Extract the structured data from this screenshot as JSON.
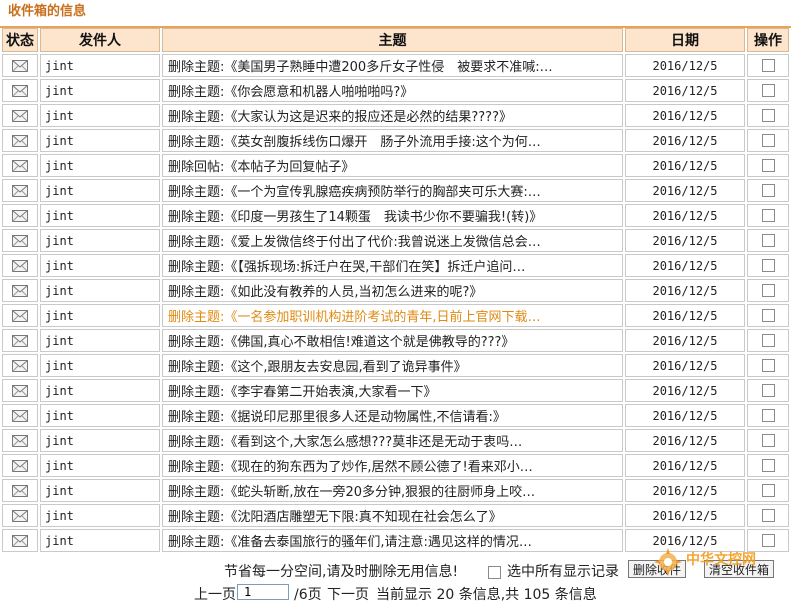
{
  "page": {
    "title": "收件箱的信息"
  },
  "table": {
    "headers": {
      "status": "状态",
      "sender": "发件人",
      "subject": "主题",
      "date": "日期",
      "op": "操作"
    },
    "rows": [
      {
        "sender": "jint",
        "subject": "删除主题:《美国男子熟睡中遭200多斤女子性侵　被要求不准喊:…",
        "date": "2016/12/5"
      },
      {
        "sender": "jint",
        "subject": "删除主题:《你会愿意和机器人啪啪啪吗?》",
        "date": "2016/12/5"
      },
      {
        "sender": "jint",
        "subject": "删除主题:《大家认为这是迟来的报应还是必然的结果????》",
        "date": "2016/12/5"
      },
      {
        "sender": "jint",
        "subject": "删除主题:《英女剖腹拆线伤口爆开　肠子外流用手接:这个为何…",
        "date": "2016/12/5"
      },
      {
        "sender": "jint",
        "subject": "删除回帖:《本帖子为回复帖子》",
        "date": "2016/12/5"
      },
      {
        "sender": "jint",
        "subject": "删除主题:《一个为宣传乳腺癌疾病预防举行的胸部夹可乐大赛:…",
        "date": "2016/12/5"
      },
      {
        "sender": "jint",
        "subject": "删除主题:《印度一男孩生了14颗蛋　我读书少你不要骗我!(转)》",
        "date": "2016/12/5"
      },
      {
        "sender": "jint",
        "subject": "删除主题:《爱上发微信终于付出了代价:我曾说迷上发微信总会…",
        "date": "2016/12/5"
      },
      {
        "sender": "jint",
        "subject": "删除主题:《【强拆现场:拆迁户在哭,干部们在笑】拆迁户追问…",
        "date": "2016/12/5"
      },
      {
        "sender": "jint",
        "subject": "删除主题:《如此没有教养的人员,当初怎么进来的呢?》",
        "date": "2016/12/5"
      },
      {
        "sender": "jint",
        "subject": "删除主题:《一名参加职训机构进阶考试的青年,日前上官网下载…",
        "date": "2016/12/5",
        "highlight": true
      },
      {
        "sender": "jint",
        "subject": "删除主题:《佛国,真心不敢相信!难道这个就是佛教导的???》",
        "date": "2016/12/5"
      },
      {
        "sender": "jint",
        "subject": "删除主题:《这个,跟朋友去安息园,看到了诡异事件》",
        "date": "2016/12/5"
      },
      {
        "sender": "jint",
        "subject": "删除主题:《李宇春第二开始表演,大家看一下》",
        "date": "2016/12/5"
      },
      {
        "sender": "jint",
        "subject": "删除主题:《据说印尼那里很多人还是动物属性,不信请看:》",
        "date": "2016/12/5"
      },
      {
        "sender": "jint",
        "subject": "删除主题:《看到这个,大家怎么感想???莫非还是无动于衷吗…",
        "date": "2016/12/5"
      },
      {
        "sender": "jint",
        "subject": "删除主题:《现在的狗东西为了炒作,居然不顾公德了!看来邓小…",
        "date": "2016/12/5"
      },
      {
        "sender": "jint",
        "subject": "删除主题:《蛇头斩断,放在一旁20多分钟,狠狠的往厨师身上咬…",
        "date": "2016/12/5"
      },
      {
        "sender": "jint",
        "subject": "删除主题:《沈阳酒店雕塑无下限:真不知现在社会怎么了》",
        "date": "2016/12/5"
      },
      {
        "sender": "jint",
        "subject": "删除主题:《准备去泰国旅行的骚年们,请注意:遇见这样的情况…",
        "date": "2016/12/5"
      }
    ]
  },
  "footer": {
    "notice": "节省每一分空间,请及时删除无用信息!",
    "select_all": "选中所有显示记录",
    "delete_btn": "删除收件",
    "clear_btn": "清空收件箱"
  },
  "pagination": {
    "prev": "上一页",
    "page_value": "1",
    "total_pages": "/6页",
    "next": "下一页",
    "summary": "当前显示 20 条信息,共 105 条信息"
  },
  "logo": {
    "text": "中华文控网"
  },
  "colors": {
    "accent": "#e8a25a",
    "title": "#c8701e",
    "header_bg": "#fde4cc",
    "highlight": "#e08a12"
  }
}
